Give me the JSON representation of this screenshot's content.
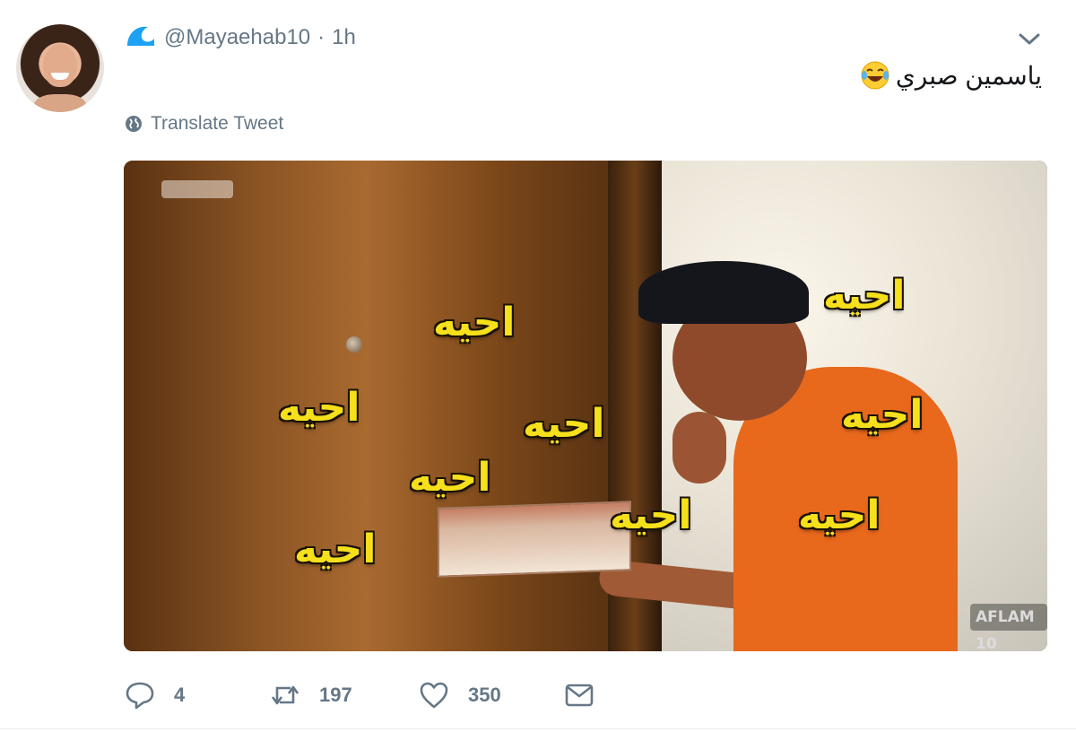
{
  "tweet": {
    "handle": "@Mayaehab10",
    "separator": "·",
    "time": "1h",
    "text": "ياسمين صبري",
    "emoji_icon": "face-with-tears-of-joy-icon",
    "translate_label": "Translate Tweet",
    "avatar_icon": "user-avatar",
    "brand_icon": "wave-logo-icon"
  },
  "media": {
    "overlay_words": [
      "احيه",
      "احيه",
      "احيه",
      "احيه",
      "احيه",
      "احيه",
      "احيه",
      "احيه",
      "احيه"
    ],
    "watermark_right": "AFLAM 10",
    "overlay_color": "#f5e01b"
  },
  "actions": {
    "reply_count": "4",
    "retweet_count": "197",
    "like_count": "350",
    "reply_icon": "reply-icon",
    "retweet_icon": "retweet-icon",
    "like_icon": "heart-icon",
    "dm_icon": "envelope-icon"
  },
  "colors": {
    "muted": "#657786",
    "brand": "#1da1f2"
  }
}
